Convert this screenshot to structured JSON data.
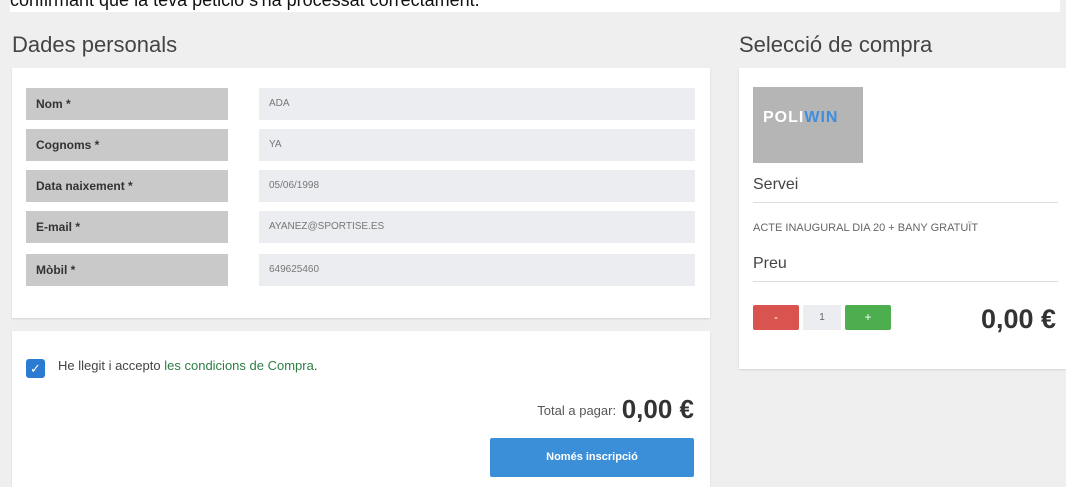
{
  "banner": {
    "text": "confirmant que la teva petició s'ha processat correctament."
  },
  "personal": {
    "title": "Dades personals",
    "fields": [
      {
        "label": "Nom *",
        "value": "ADA"
      },
      {
        "label": "Cognoms *",
        "value": "YA"
      },
      {
        "label": "Data naixement *",
        "value": "05/06/1998"
      },
      {
        "label": "E-mail *",
        "value": "AYANEZ@SPORTISE.ES"
      },
      {
        "label": "Mòbil *",
        "value": "649625460"
      }
    ]
  },
  "terms": {
    "checked": true,
    "prefix": "He llegit i accepto",
    "link": "les condicions de Compra",
    "suffix": "."
  },
  "total": {
    "label": "Total a pagar:",
    "value": "0,00 €"
  },
  "pay_button": {
    "label": "Només inscripció"
  },
  "purchase": {
    "title": "Selecció de compra",
    "logo_text_a": "POLI",
    "logo_text_b": "WIN",
    "service_label": "Servei",
    "service_value": "ACTE INAUGURAL DIA 20 + BANY GRATUÏT",
    "price_label": "Preu",
    "minus": "-",
    "qty": "1",
    "plus": "+",
    "price": "0,00 €"
  }
}
